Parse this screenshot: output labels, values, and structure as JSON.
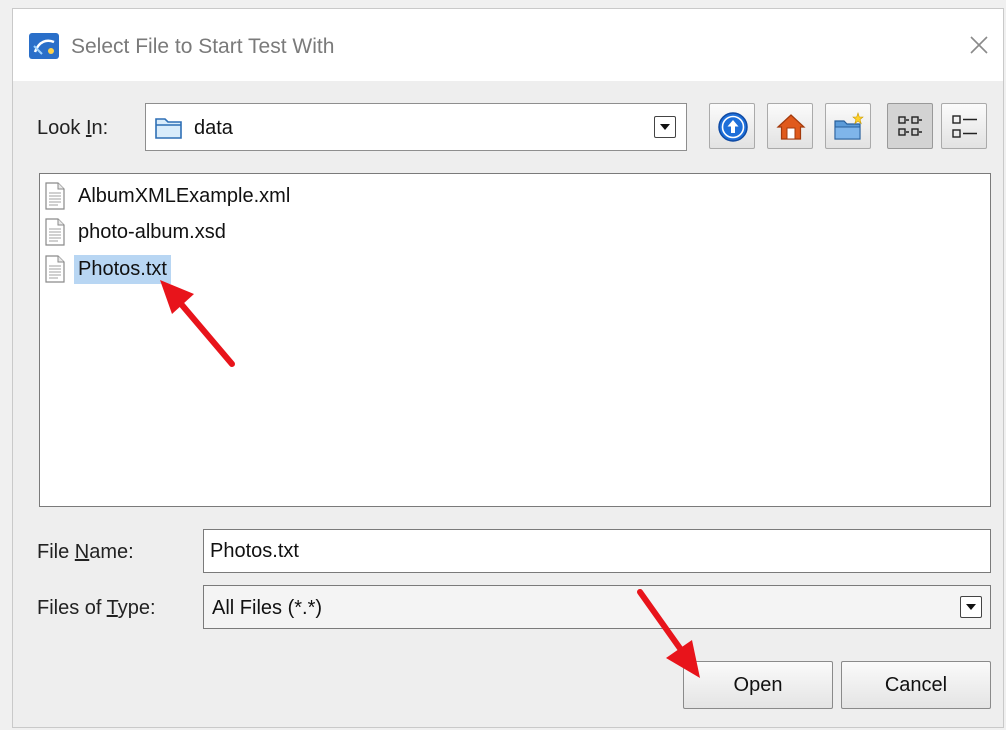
{
  "window": {
    "title": "Select File to Start Test With",
    "app_icon": "app-logo-icon",
    "close_icon": "close-icon"
  },
  "look_in": {
    "label_pre": "Look ",
    "label_ul": "I",
    "label_post": "n:",
    "value": "data",
    "icon": "folder-icon"
  },
  "toolbar": [
    {
      "name": "up-one-level-button",
      "icon": "up-arrow-icon"
    },
    {
      "name": "home-button",
      "icon": "home-icon"
    },
    {
      "name": "new-folder-button",
      "icon": "new-folder-icon"
    },
    {
      "name": "list-view-button",
      "icon": "list-view-icon",
      "pressed": true
    },
    {
      "name": "details-view-button",
      "icon": "details-view-icon"
    }
  ],
  "files": [
    {
      "name": "AlbumXMLExample.xml",
      "selected": false
    },
    {
      "name": "photo-album.xsd",
      "selected": false
    },
    {
      "name": "Photos.txt",
      "selected": true
    }
  ],
  "file_name": {
    "label_pre": "File ",
    "label_ul": "N",
    "label_post": "ame:",
    "value": "Photos.txt"
  },
  "file_type": {
    "label_pre": "Files of ",
    "label_ul": "T",
    "label_post": "ype:",
    "value": "All Files (*.*)"
  },
  "buttons": {
    "open": "Open",
    "cancel": "Cancel"
  },
  "colors": {
    "selection": "#b8d6f3",
    "annotation_arrow": "#e8141b",
    "up_button": "#1e6fd9",
    "home_roof": "#e05a1c"
  }
}
